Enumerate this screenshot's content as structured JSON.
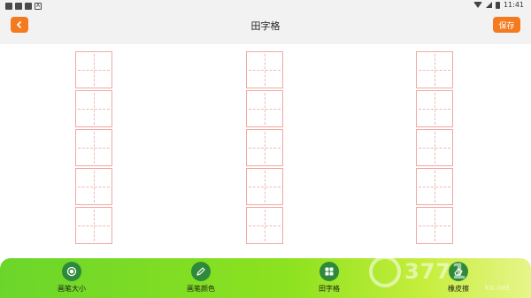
{
  "status_bar": {
    "time": "11:41",
    "sim_badge": "A"
  },
  "header": {
    "title": "田字格",
    "save_label": "保存"
  },
  "grid": {
    "columns": 3,
    "cells_per_column": 5
  },
  "toolbar": {
    "items": [
      {
        "label": "画笔大小",
        "icon": "brush-size-icon"
      },
      {
        "label": "画笔颜色",
        "icon": "pencil-icon"
      },
      {
        "label": "田字格",
        "icon": "grid-icon"
      },
      {
        "label": "橡皮擦",
        "icon": "eraser-icon"
      }
    ]
  },
  "watermark": {
    "text": "3771",
    "sub": "kx.net"
  },
  "colors": {
    "accent": "#f47a20",
    "toolbar_start": "#6bd62a",
    "toolbar_end": "#e7f58a",
    "grid_line": "#f0a8a0",
    "icon_bg": "#2e8a3a"
  }
}
